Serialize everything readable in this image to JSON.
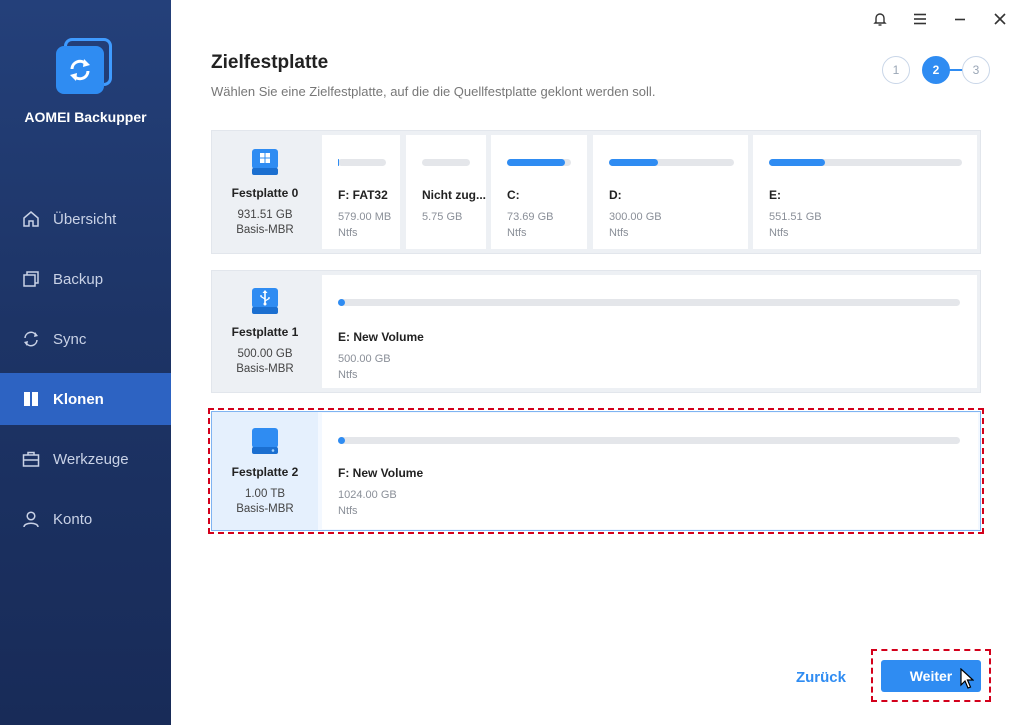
{
  "app": {
    "name": "AOMEI Backupper"
  },
  "sidebar": {
    "items": [
      {
        "label": "Übersicht",
        "icon": "home-icon",
        "active": false
      },
      {
        "label": "Backup",
        "icon": "backup-icon",
        "active": false
      },
      {
        "label": "Sync",
        "icon": "sync-icon",
        "active": false
      },
      {
        "label": "Klonen",
        "icon": "clone-icon",
        "active": true
      },
      {
        "label": "Werkzeuge",
        "icon": "toolbox-icon",
        "active": false
      },
      {
        "label": "Konto",
        "icon": "user-icon",
        "active": false
      }
    ]
  },
  "window_controls": [
    "bell-icon",
    "menu-icon",
    "minimize-icon",
    "close-icon"
  ],
  "page": {
    "title": "Zielfestplatte",
    "subtitle": "Wählen Sie eine Zielfestplatte, auf die die Quellfestplatte geklont werden soll."
  },
  "steps": [
    {
      "label": "1"
    },
    {
      "label": "2",
      "active": true
    },
    {
      "label": "3"
    }
  ],
  "disks": [
    {
      "name": "Festplatte 0",
      "size": "931.51 GB",
      "style": "Basis-MBR",
      "icon": "windows-disk-icon",
      "partitions": [
        {
          "label": "F: FAT32",
          "size": "579.00 MB",
          "fs": "Ntfs",
          "usage": 0.03
        },
        {
          "label": "Nicht zug...",
          "size": "5.75 GB",
          "fs": "",
          "usage": 0
        },
        {
          "label": "C:",
          "size": "73.69 GB",
          "fs": "Ntfs",
          "usage": 0.9
        },
        {
          "label": "D:",
          "size": "300.00 GB",
          "fs": "Ntfs",
          "usage": 0.39
        },
        {
          "label": "E:",
          "size": "551.51 GB",
          "fs": "Ntfs",
          "usage": 0.29
        }
      ]
    },
    {
      "name": "Festplatte 1",
      "size": "500.00 GB",
      "style": "Basis-MBR",
      "icon": "usb-disk-icon",
      "partitions": [
        {
          "label": "E: New Volume",
          "size": "500.00 GB",
          "fs": "Ntfs",
          "usage": 0.005
        }
      ]
    },
    {
      "name": "Festplatte 2",
      "size": "1.00 TB",
      "style": "Basis-MBR",
      "icon": "disk-icon",
      "selected": true,
      "partitions": [
        {
          "label": "F: New Volume",
          "size": "1024.00 GB",
          "fs": "Ntfs",
          "usage": 0.005
        }
      ]
    }
  ],
  "buttons": {
    "back": "Zurück",
    "next": "Weiter"
  },
  "colors": {
    "accent": "#2f8cf2",
    "sidebar": "#1d3466",
    "highlight": "#d3001b"
  }
}
